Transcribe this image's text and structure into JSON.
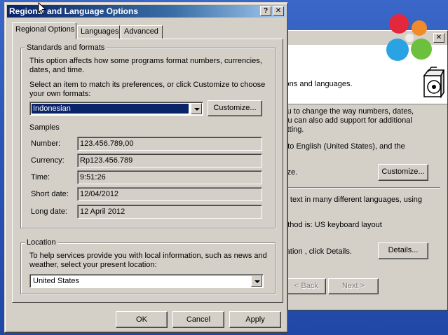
{
  "dialog": {
    "title": "Regional and Language Options",
    "help_glyph": "?",
    "close_glyph": "✕",
    "tabs": [
      {
        "label": "Regional Options",
        "active": true
      },
      {
        "label": "Languages",
        "active": false
      },
      {
        "label": "Advanced",
        "active": false
      }
    ],
    "standards": {
      "legend": "Standards and formats",
      "desc_line1": "This option affects how some programs format numbers, currencies,",
      "desc_line2": "dates, and time.",
      "select_line1": "Select an item to match its preferences, or click Customize to choose",
      "select_line2": "your own formats:",
      "selected_format": "Indonesian",
      "customize_label": "Customize...",
      "samples_heading": "Samples",
      "samples": [
        {
          "label": "Number:",
          "value": "123.456.789,00"
        },
        {
          "label": "Currency:",
          "value": "Rp123.456.789"
        },
        {
          "label": "Time:",
          "value": "9:51:26"
        },
        {
          "label": "Short date:",
          "value": "12/04/2012"
        },
        {
          "label": "Long date:",
          "value": "12 April 2012"
        }
      ]
    },
    "location": {
      "legend": "Location",
      "desc_line1": "To help services provide you with local information, such as news and",
      "desc_line2": "weather, select your present location:",
      "selected_location": "United States"
    },
    "buttons": {
      "ok": "OK",
      "cancel": "Cancel",
      "apply": "Apply"
    }
  },
  "background_window": {
    "close_glyph": "✕",
    "header_text": "gions and languages.",
    "lines": [
      "you to change the way numbers, dates,",
      "You can also add support for additional",
      "setting.",
      "et to English (United States), and the",
      "mize.",
      "ter text in many different languages, using",
      "nethod is: US keyboard layout",
      "uration , click Details."
    ],
    "customize_label": "Customize...",
    "details_label": "Details...",
    "back_label": "< Back",
    "next_label": "Next >"
  },
  "colors": {
    "desktop": "#2b56b8",
    "title_active": "#0a246a",
    "face": "#d4d0c8"
  }
}
